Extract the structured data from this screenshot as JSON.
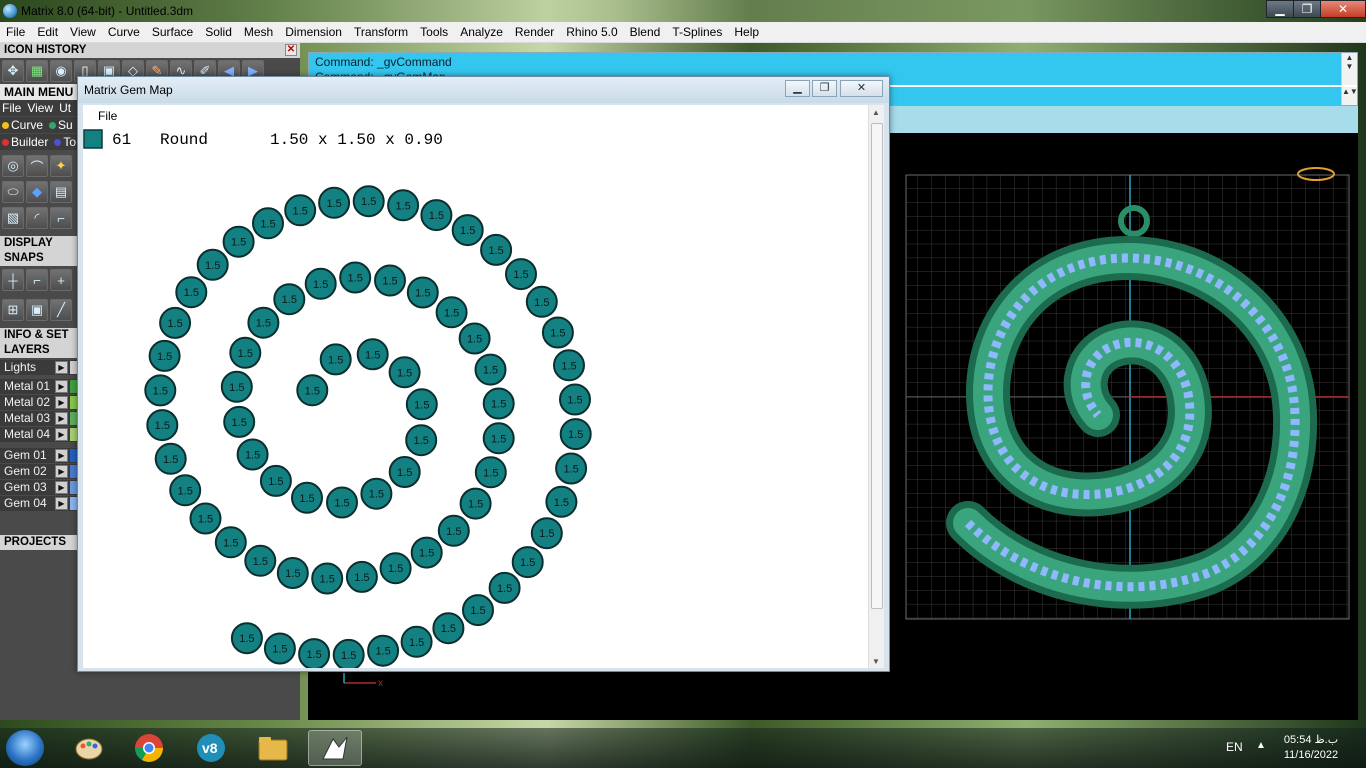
{
  "window": {
    "title": "Matrix 8.0 (64-bit) - Untitled.3dm",
    "min": "▁",
    "max": "❐",
    "close": "✕"
  },
  "menubar": [
    "File",
    "Edit",
    "View",
    "Curve",
    "Surface",
    "Solid",
    "Mesh",
    "Dimension",
    "Transform",
    "Tools",
    "Analyze",
    "Render",
    "Rhino 5.0",
    "Blend",
    "T-Splines",
    "Help"
  ],
  "leftpanel": {
    "icon_history": "ICON HISTORY",
    "main_menu": "MAIN MENU",
    "sub_menu": [
      "File",
      "View",
      "Ut"
    ],
    "row_a": [
      {
        "label": "Curve",
        "color": "#f0c020"
      },
      {
        "label": "Su",
        "color": "#2fa86a"
      }
    ],
    "row_b": [
      {
        "label": "Builder",
        "color": "#e03030"
      },
      {
        "label": "To",
        "color": "#5050d0"
      }
    ],
    "display": "DISPLAY",
    "snaps": "SNAPS",
    "info": "INFO & SET",
    "layers": "LAYERS",
    "projects": "PROJECTS",
    "layer_items": [
      {
        "name": "Lights",
        "swatch": "#cfcfcf"
      },
      {
        "name": "Metal 01",
        "swatch": "#3fa03f"
      },
      {
        "name": "Metal 02",
        "swatch": "#88c84a"
      },
      {
        "name": "Metal 03",
        "swatch": "#5cb05c"
      },
      {
        "name": "Metal 04",
        "swatch": "#a8d070"
      },
      {
        "name": "Gem 01",
        "swatch": "#2060c0"
      },
      {
        "name": "Gem 02",
        "swatch": "#4a7ad0"
      },
      {
        "name": "Gem 03",
        "swatch": "#6a9ae0"
      },
      {
        "name": "Gem 04",
        "swatch": "#8ab4f0"
      }
    ]
  },
  "command": {
    "line1": "Command: _gvCommand",
    "line1b": "Command: _gvGemMap",
    "line2": "Command:"
  },
  "gemmap": {
    "title": "Matrix Gem Map",
    "menu_file": "File",
    "count": "61",
    "shape": "Round",
    "dims": "1.50 x 1.50 x 0.90",
    "gem_label": "1.5",
    "gem_color": "#138182",
    "gem_count_shown": 73
  },
  "taskbar": {
    "lang": "EN",
    "time": "05:54 ب.ظ",
    "date": "11/16/2022"
  },
  "colors": {
    "pendant": "#1f7a5a",
    "pendant_light": "#3aa57d",
    "gem_blue": "#8fb8ff",
    "cmd_bg": "#33c6ee"
  }
}
